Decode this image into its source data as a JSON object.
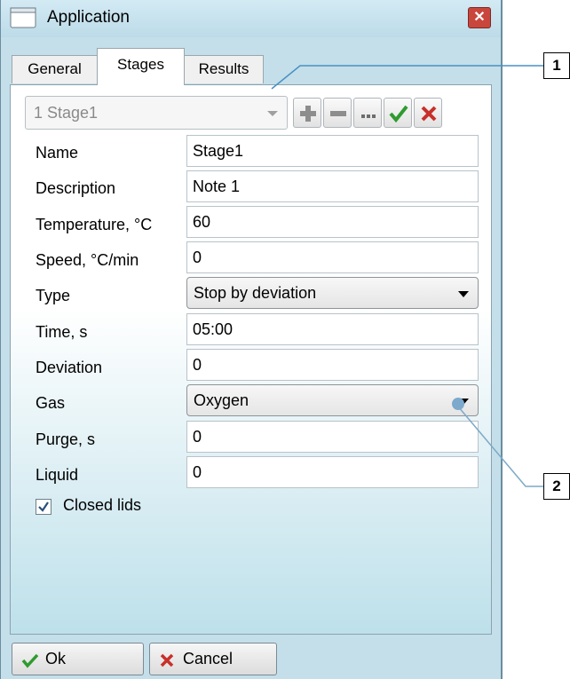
{
  "window": {
    "title": "Application"
  },
  "tabs": [
    {
      "label": "General",
      "active": false
    },
    {
      "label": "Stages",
      "active": true
    },
    {
      "label": "Results",
      "active": false
    }
  ],
  "stage_selector": {
    "value": "1 Stage1"
  },
  "toolbar": {
    "add_icon": "plus-icon",
    "remove_icon": "minus-icon",
    "more_icon": "ellipsis-icon",
    "apply_icon": "check-icon",
    "discard_icon": "cross-icon"
  },
  "fields": [
    {
      "label": "Name",
      "value": "Stage1",
      "kind": "text"
    },
    {
      "label": "Description",
      "value": "Note 1",
      "kind": "text"
    },
    {
      "label": "Temperature, °C",
      "value": "60",
      "kind": "text"
    },
    {
      "label": "Speed, °C/min",
      "value": "0",
      "kind": "text"
    },
    {
      "label": "Type",
      "value": "Stop by deviation",
      "kind": "select"
    },
    {
      "label": "Time, s",
      "value": "05:00",
      "kind": "text"
    },
    {
      "label": "Deviation",
      "value": "0",
      "kind": "text"
    },
    {
      "label": "Gas",
      "value": "Oxygen",
      "kind": "select"
    },
    {
      "label": "Purge, s",
      "value": "0",
      "kind": "text"
    },
    {
      "label": "Liquid",
      "value": "0",
      "kind": "text"
    }
  ],
  "closed_lids": {
    "label": "Closed lids",
    "checked": true
  },
  "buttons": {
    "ok": "Ok",
    "cancel": "Cancel"
  },
  "callouts": [
    "1",
    "2"
  ],
  "colors": {
    "apply_green": "#2e9b2e",
    "discard_red": "#c8302a",
    "background_tint": "#bde0ea"
  }
}
